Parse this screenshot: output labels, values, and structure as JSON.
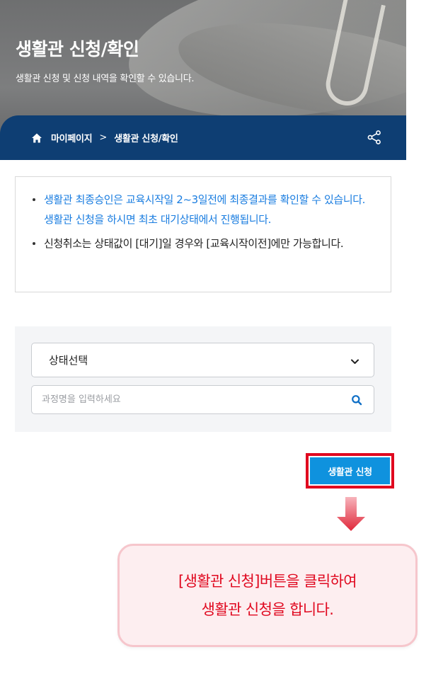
{
  "header": {
    "title": "생활관 신청/확인",
    "subtitle": "생활관 신청 및 신청 내역을 확인할 수 있습니다."
  },
  "breadcrumb": {
    "items": [
      "마이페이지",
      "생활관 신청/확인"
    ],
    "separator": ">"
  },
  "notice": {
    "items": [
      "생활관 최종승인은 교육시작일 2~3일전에 최종결과를 확인할 수 있습니다. 생활관 신청을 하시면 최초 대기상태에서 진행됩니다.",
      "신청취소는 상태값이 [대기]일 경우와 [교육시작이전]에만 가능합니다."
    ]
  },
  "filter": {
    "status_select": "상태선택",
    "search_placeholder": "과정명을 입력하세요"
  },
  "actions": {
    "apply_button": "생활관 신청"
  },
  "callout": {
    "line1": "[생활관 신청]버튼을 클릭하여",
    "line2": "생활관 신청을 합니다."
  },
  "colors": {
    "breadcrumb_bg": "#0e3e73",
    "notice_blue": "#1a7de0",
    "button_blue": "#0f92de",
    "highlight_red": "#e0081f",
    "callout_bg": "#fdeef0"
  }
}
